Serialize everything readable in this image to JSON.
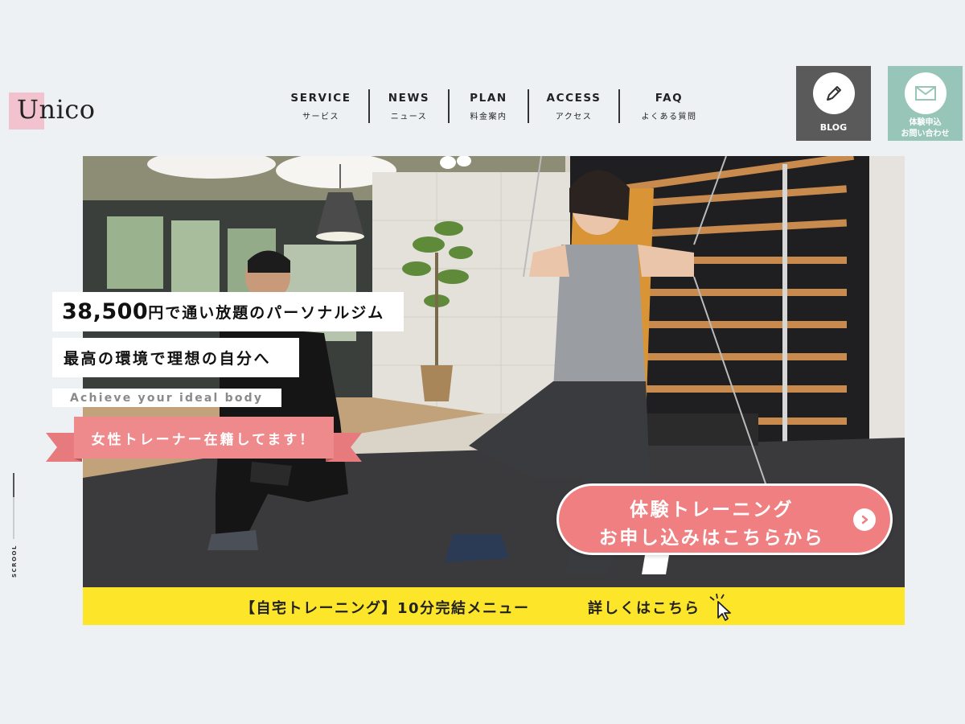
{
  "logo": {
    "text": "Unico"
  },
  "nav": [
    {
      "en": "SERVICE",
      "ja": "サービス"
    },
    {
      "en": "NEWS",
      "ja": "ニュース"
    },
    {
      "en": "PLAN",
      "ja": "料金案内"
    },
    {
      "en": "ACCESS",
      "ja": "アクセス"
    },
    {
      "en": "FAQ",
      "ja": "よくある質問"
    }
  ],
  "side_buttons": {
    "blog": {
      "label": "BLOG",
      "icon": "pencil-icon",
      "color": "#5a5a5a"
    },
    "contact": {
      "label_line1": "体験申込",
      "label_line2": "お問い合わせ",
      "icon": "envelope-icon",
      "color": "#97c6b8"
    }
  },
  "hero": {
    "copy_price": "38,500",
    "copy_line1_rest": "円で通い放題のパーソナルジム",
    "copy_line2": "最高の環境で理想の自分へ",
    "copy_line3": "Achieve your ideal body",
    "ribbon": "女性トレーナー在籍してます！",
    "ribbon_color": "#ef7f81",
    "cta_line1": "体験トレーニング",
    "cta_line2": "お申し込みはこちらから",
    "cta_color": "#ef7f81"
  },
  "banner": {
    "title": "【自宅トレーニング】10分完結メニュー",
    "link": "詳しくはこちら",
    "color": "#fde52a"
  },
  "scroll": {
    "label": "SCROOL"
  }
}
